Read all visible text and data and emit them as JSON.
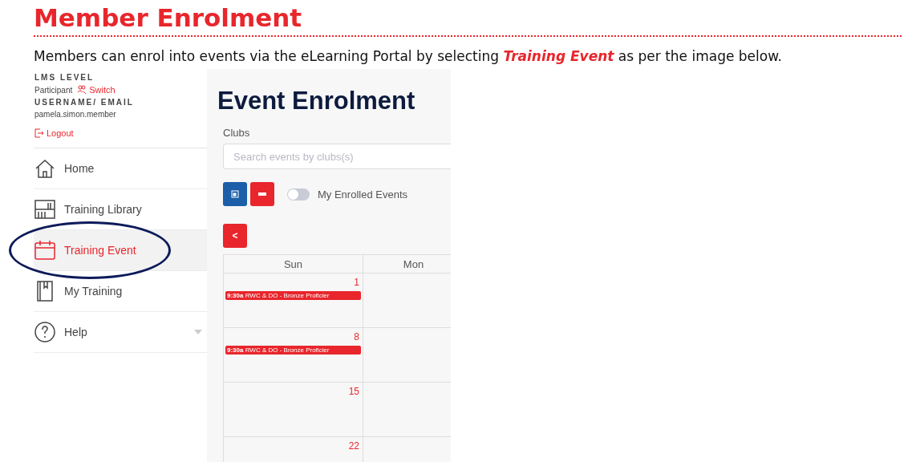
{
  "heading": "Member Enrolment",
  "intro": "Members can enrol into events via the eLearning Portal by selecting **Training Event** as per the image below.",
  "sidebar": {
    "level_label": "LMS LEVEL",
    "level_value": "Participant",
    "switch_label": "Switch",
    "user_label": "USERNAME/ EMAIL",
    "user_value": "pamela.simon.member",
    "logout_label": "Logout",
    "items": [
      {
        "label": "Home",
        "kind": "home",
        "selected": false,
        "collapsible": false
      },
      {
        "label": "Training Library",
        "kind": "library",
        "selected": false,
        "collapsible": false
      },
      {
        "label": "Training Event",
        "kind": "calendar",
        "selected": true,
        "collapsible": false,
        "circled": true
      },
      {
        "label": "My Training",
        "kind": "book",
        "selected": false,
        "collapsible": false
      },
      {
        "label": "Help",
        "kind": "help",
        "selected": false,
        "collapsible": true
      }
    ]
  },
  "main": {
    "title": "Event Enrolment",
    "clubs_label": "Clubs",
    "search_placeholder": "Search events by clubs(s)",
    "toggle": {
      "label": "My Enrolled Events",
      "on": false
    },
    "prev_button": "<",
    "columns": [
      "Sun",
      "Mon"
    ],
    "weeks": [
      {
        "day": "1",
        "events": [
          {
            "time": "9:30a",
            "title": "RWC & DO - Bronze Proficier"
          }
        ]
      },
      {
        "day": "8",
        "events": [
          {
            "time": "9:30a",
            "title": "RWC & DO - Bronze Proficier"
          }
        ]
      },
      {
        "day": "15"
      },
      {
        "day": "22"
      }
    ]
  }
}
